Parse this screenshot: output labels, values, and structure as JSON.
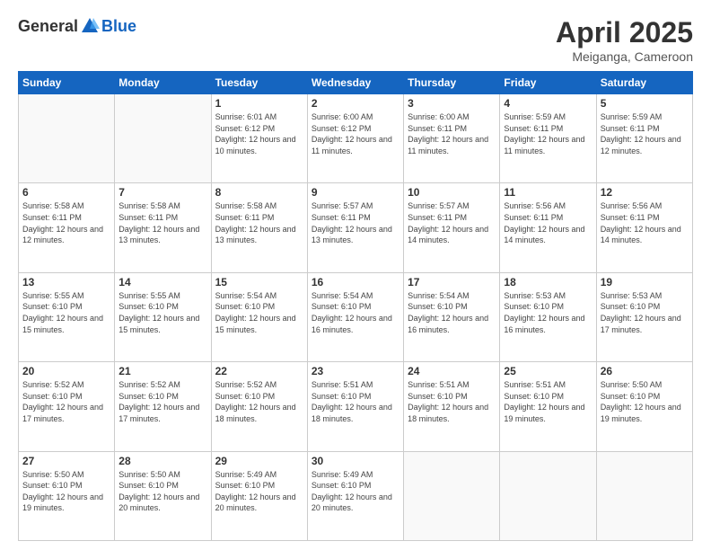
{
  "header": {
    "logo_general": "General",
    "logo_blue": "Blue",
    "title": "April 2025",
    "location": "Meiganga, Cameroon"
  },
  "weekdays": [
    "Sunday",
    "Monday",
    "Tuesday",
    "Wednesday",
    "Thursday",
    "Friday",
    "Saturday"
  ],
  "weeks": [
    [
      {
        "day": "",
        "info": ""
      },
      {
        "day": "",
        "info": ""
      },
      {
        "day": "1",
        "info": "Sunrise: 6:01 AM\nSunset: 6:12 PM\nDaylight: 12 hours and 10 minutes."
      },
      {
        "day": "2",
        "info": "Sunrise: 6:00 AM\nSunset: 6:12 PM\nDaylight: 12 hours and 11 minutes."
      },
      {
        "day": "3",
        "info": "Sunrise: 6:00 AM\nSunset: 6:11 PM\nDaylight: 12 hours and 11 minutes."
      },
      {
        "day": "4",
        "info": "Sunrise: 5:59 AM\nSunset: 6:11 PM\nDaylight: 12 hours and 11 minutes."
      },
      {
        "day": "5",
        "info": "Sunrise: 5:59 AM\nSunset: 6:11 PM\nDaylight: 12 hours and 12 minutes."
      }
    ],
    [
      {
        "day": "6",
        "info": "Sunrise: 5:58 AM\nSunset: 6:11 PM\nDaylight: 12 hours and 12 minutes."
      },
      {
        "day": "7",
        "info": "Sunrise: 5:58 AM\nSunset: 6:11 PM\nDaylight: 12 hours and 13 minutes."
      },
      {
        "day": "8",
        "info": "Sunrise: 5:58 AM\nSunset: 6:11 PM\nDaylight: 12 hours and 13 minutes."
      },
      {
        "day": "9",
        "info": "Sunrise: 5:57 AM\nSunset: 6:11 PM\nDaylight: 12 hours and 13 minutes."
      },
      {
        "day": "10",
        "info": "Sunrise: 5:57 AM\nSunset: 6:11 PM\nDaylight: 12 hours and 14 minutes."
      },
      {
        "day": "11",
        "info": "Sunrise: 5:56 AM\nSunset: 6:11 PM\nDaylight: 12 hours and 14 minutes."
      },
      {
        "day": "12",
        "info": "Sunrise: 5:56 AM\nSunset: 6:11 PM\nDaylight: 12 hours and 14 minutes."
      }
    ],
    [
      {
        "day": "13",
        "info": "Sunrise: 5:55 AM\nSunset: 6:10 PM\nDaylight: 12 hours and 15 minutes."
      },
      {
        "day": "14",
        "info": "Sunrise: 5:55 AM\nSunset: 6:10 PM\nDaylight: 12 hours and 15 minutes."
      },
      {
        "day": "15",
        "info": "Sunrise: 5:54 AM\nSunset: 6:10 PM\nDaylight: 12 hours and 15 minutes."
      },
      {
        "day": "16",
        "info": "Sunrise: 5:54 AM\nSunset: 6:10 PM\nDaylight: 12 hours and 16 minutes."
      },
      {
        "day": "17",
        "info": "Sunrise: 5:54 AM\nSunset: 6:10 PM\nDaylight: 12 hours and 16 minutes."
      },
      {
        "day": "18",
        "info": "Sunrise: 5:53 AM\nSunset: 6:10 PM\nDaylight: 12 hours and 16 minutes."
      },
      {
        "day": "19",
        "info": "Sunrise: 5:53 AM\nSunset: 6:10 PM\nDaylight: 12 hours and 17 minutes."
      }
    ],
    [
      {
        "day": "20",
        "info": "Sunrise: 5:52 AM\nSunset: 6:10 PM\nDaylight: 12 hours and 17 minutes."
      },
      {
        "day": "21",
        "info": "Sunrise: 5:52 AM\nSunset: 6:10 PM\nDaylight: 12 hours and 17 minutes."
      },
      {
        "day": "22",
        "info": "Sunrise: 5:52 AM\nSunset: 6:10 PM\nDaylight: 12 hours and 18 minutes."
      },
      {
        "day": "23",
        "info": "Sunrise: 5:51 AM\nSunset: 6:10 PM\nDaylight: 12 hours and 18 minutes."
      },
      {
        "day": "24",
        "info": "Sunrise: 5:51 AM\nSunset: 6:10 PM\nDaylight: 12 hours and 18 minutes."
      },
      {
        "day": "25",
        "info": "Sunrise: 5:51 AM\nSunset: 6:10 PM\nDaylight: 12 hours and 19 minutes."
      },
      {
        "day": "26",
        "info": "Sunrise: 5:50 AM\nSunset: 6:10 PM\nDaylight: 12 hours and 19 minutes."
      }
    ],
    [
      {
        "day": "27",
        "info": "Sunrise: 5:50 AM\nSunset: 6:10 PM\nDaylight: 12 hours and 19 minutes."
      },
      {
        "day": "28",
        "info": "Sunrise: 5:50 AM\nSunset: 6:10 PM\nDaylight: 12 hours and 20 minutes."
      },
      {
        "day": "29",
        "info": "Sunrise: 5:49 AM\nSunset: 6:10 PM\nDaylight: 12 hours and 20 minutes."
      },
      {
        "day": "30",
        "info": "Sunrise: 5:49 AM\nSunset: 6:10 PM\nDaylight: 12 hours and 20 minutes."
      },
      {
        "day": "",
        "info": ""
      },
      {
        "day": "",
        "info": ""
      },
      {
        "day": "",
        "info": ""
      }
    ]
  ]
}
